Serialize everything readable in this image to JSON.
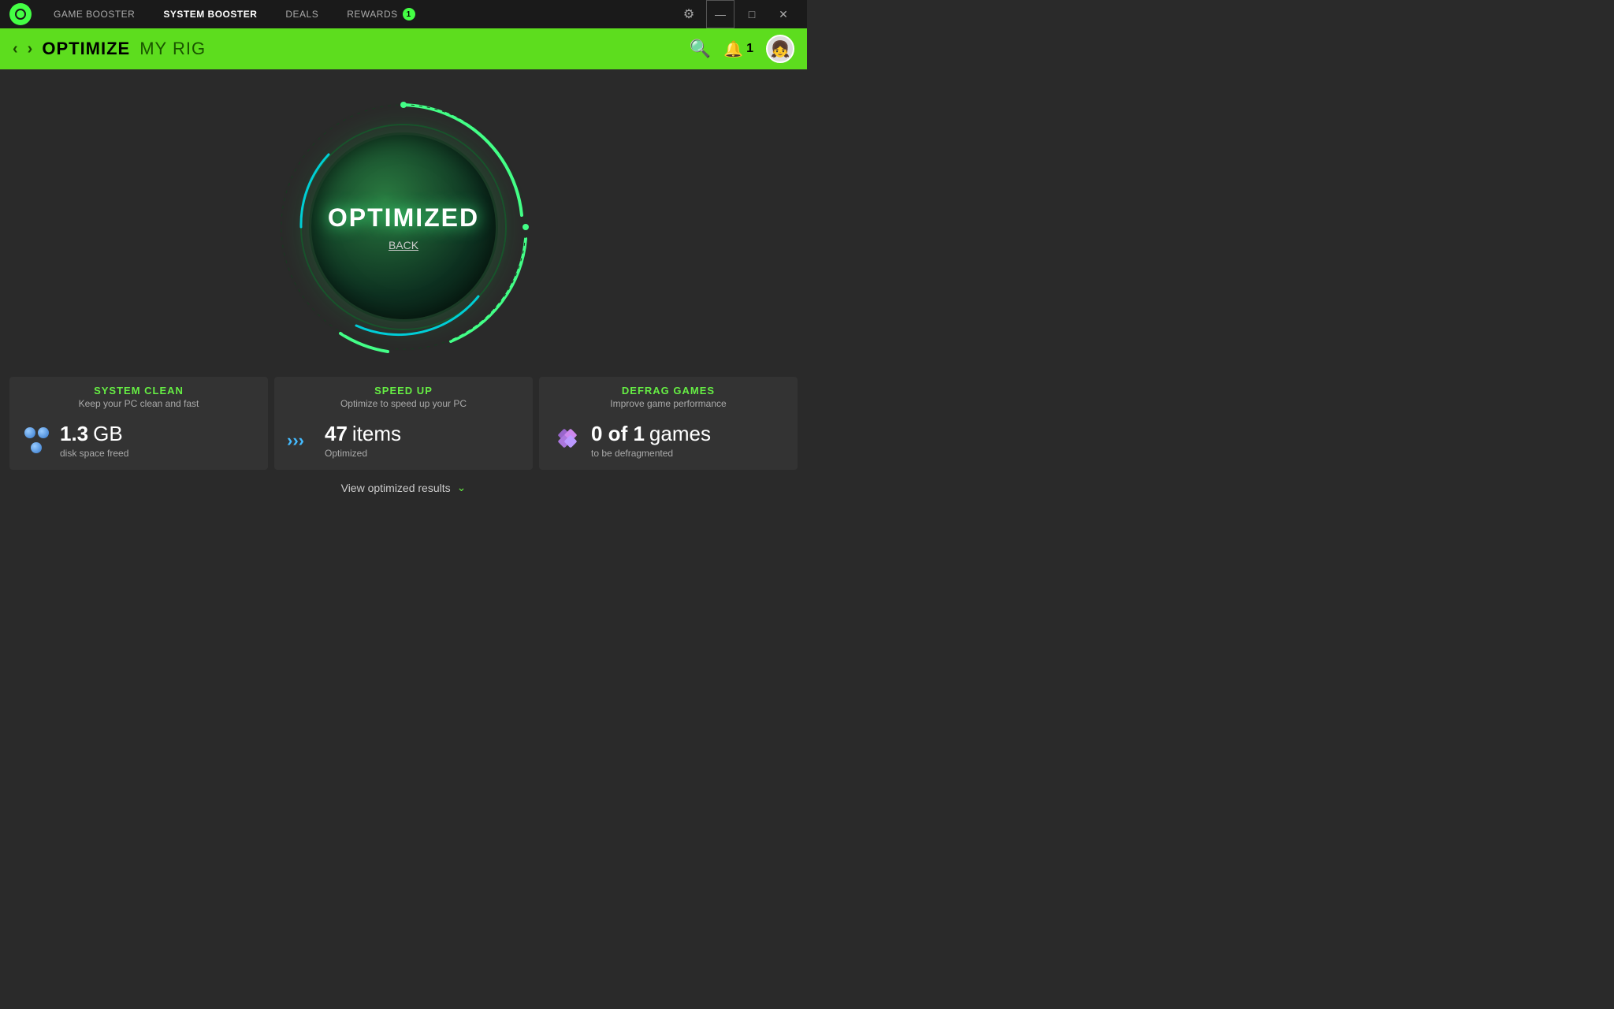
{
  "titlebar": {
    "tabs": [
      {
        "id": "game-booster",
        "label": "GAME BOOSTER",
        "active": false
      },
      {
        "id": "system-booster",
        "label": "SYSTEM BOOSTER",
        "active": true
      },
      {
        "id": "deals",
        "label": "DEALS",
        "active": false
      },
      {
        "id": "rewards",
        "label": "REWARDS",
        "active": false
      }
    ],
    "rewards_badge": "1",
    "minimize": "—",
    "restore": "□",
    "close": "✕"
  },
  "subheader": {
    "back_arrow": "‹",
    "forward_arrow": "›",
    "title": "OPTIMIZE",
    "subtitle": "MY RIG",
    "notif_count": "1"
  },
  "main": {
    "optimized_label": "OPTIMIZED",
    "back_link": "BACK"
  },
  "stats": [
    {
      "id": "system-clean",
      "title": "SYSTEM CLEAN",
      "subtitle": "Keep your PC clean and fast",
      "value": "1.3",
      "unit": "GB",
      "description": "disk space freed",
      "icon_type": "circles"
    },
    {
      "id": "speed-up",
      "title": "SPEED UP",
      "subtitle": "Optimize to speed up your PC",
      "value": "47",
      "unit": "items",
      "description": "Optimized",
      "icon_type": "arrows"
    },
    {
      "id": "defrag-games",
      "title": "DEFRAG GAMES",
      "subtitle": "Improve game performance",
      "value": "0 of 1",
      "unit": "games",
      "description": "to be defragmented",
      "icon_type": "diamond"
    }
  ],
  "view_results": {
    "label": "View optimized results",
    "arrow": "⌄"
  },
  "colors": {
    "accent_green": "#66ee44",
    "dark_bg": "#2a2a2a",
    "header_green": "#5ddd1e"
  }
}
